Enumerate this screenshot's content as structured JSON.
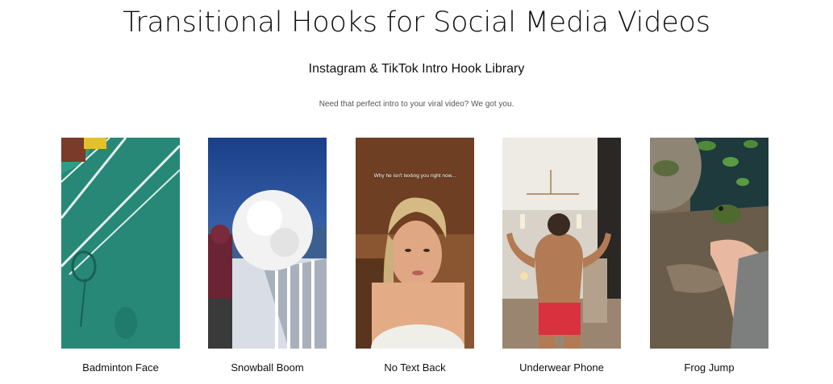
{
  "header": {
    "title": "Transitional Hooks for Social Media Videos",
    "subtitle": "Instagram & TikTok Intro Hook Library",
    "tagline": "Need that perfect intro to your viral video? We got you."
  },
  "videos": [
    {
      "label": "Badminton Face"
    },
    {
      "label": "Snowball Boom"
    },
    {
      "label": "No Text Back",
      "overlay_text": "Why he isn't texting you right now..."
    },
    {
      "label": "Underwear Phone"
    },
    {
      "label": "Frog Jump"
    }
  ]
}
